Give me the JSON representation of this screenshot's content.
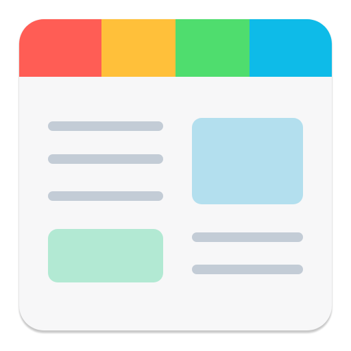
{
  "icon": {
    "name": "news-reader-app-icon",
    "colors": {
      "background": "#f7f7f8",
      "tab_red": "#ff5d55",
      "tab_yellow": "#ffc03a",
      "tab_green": "#4fdd6e",
      "tab_blue": "#0ebbe8",
      "text_line": "#c3ccd6",
      "image_block_blue": "#b3dfee",
      "image_block_green": "#b2e9d3"
    }
  }
}
